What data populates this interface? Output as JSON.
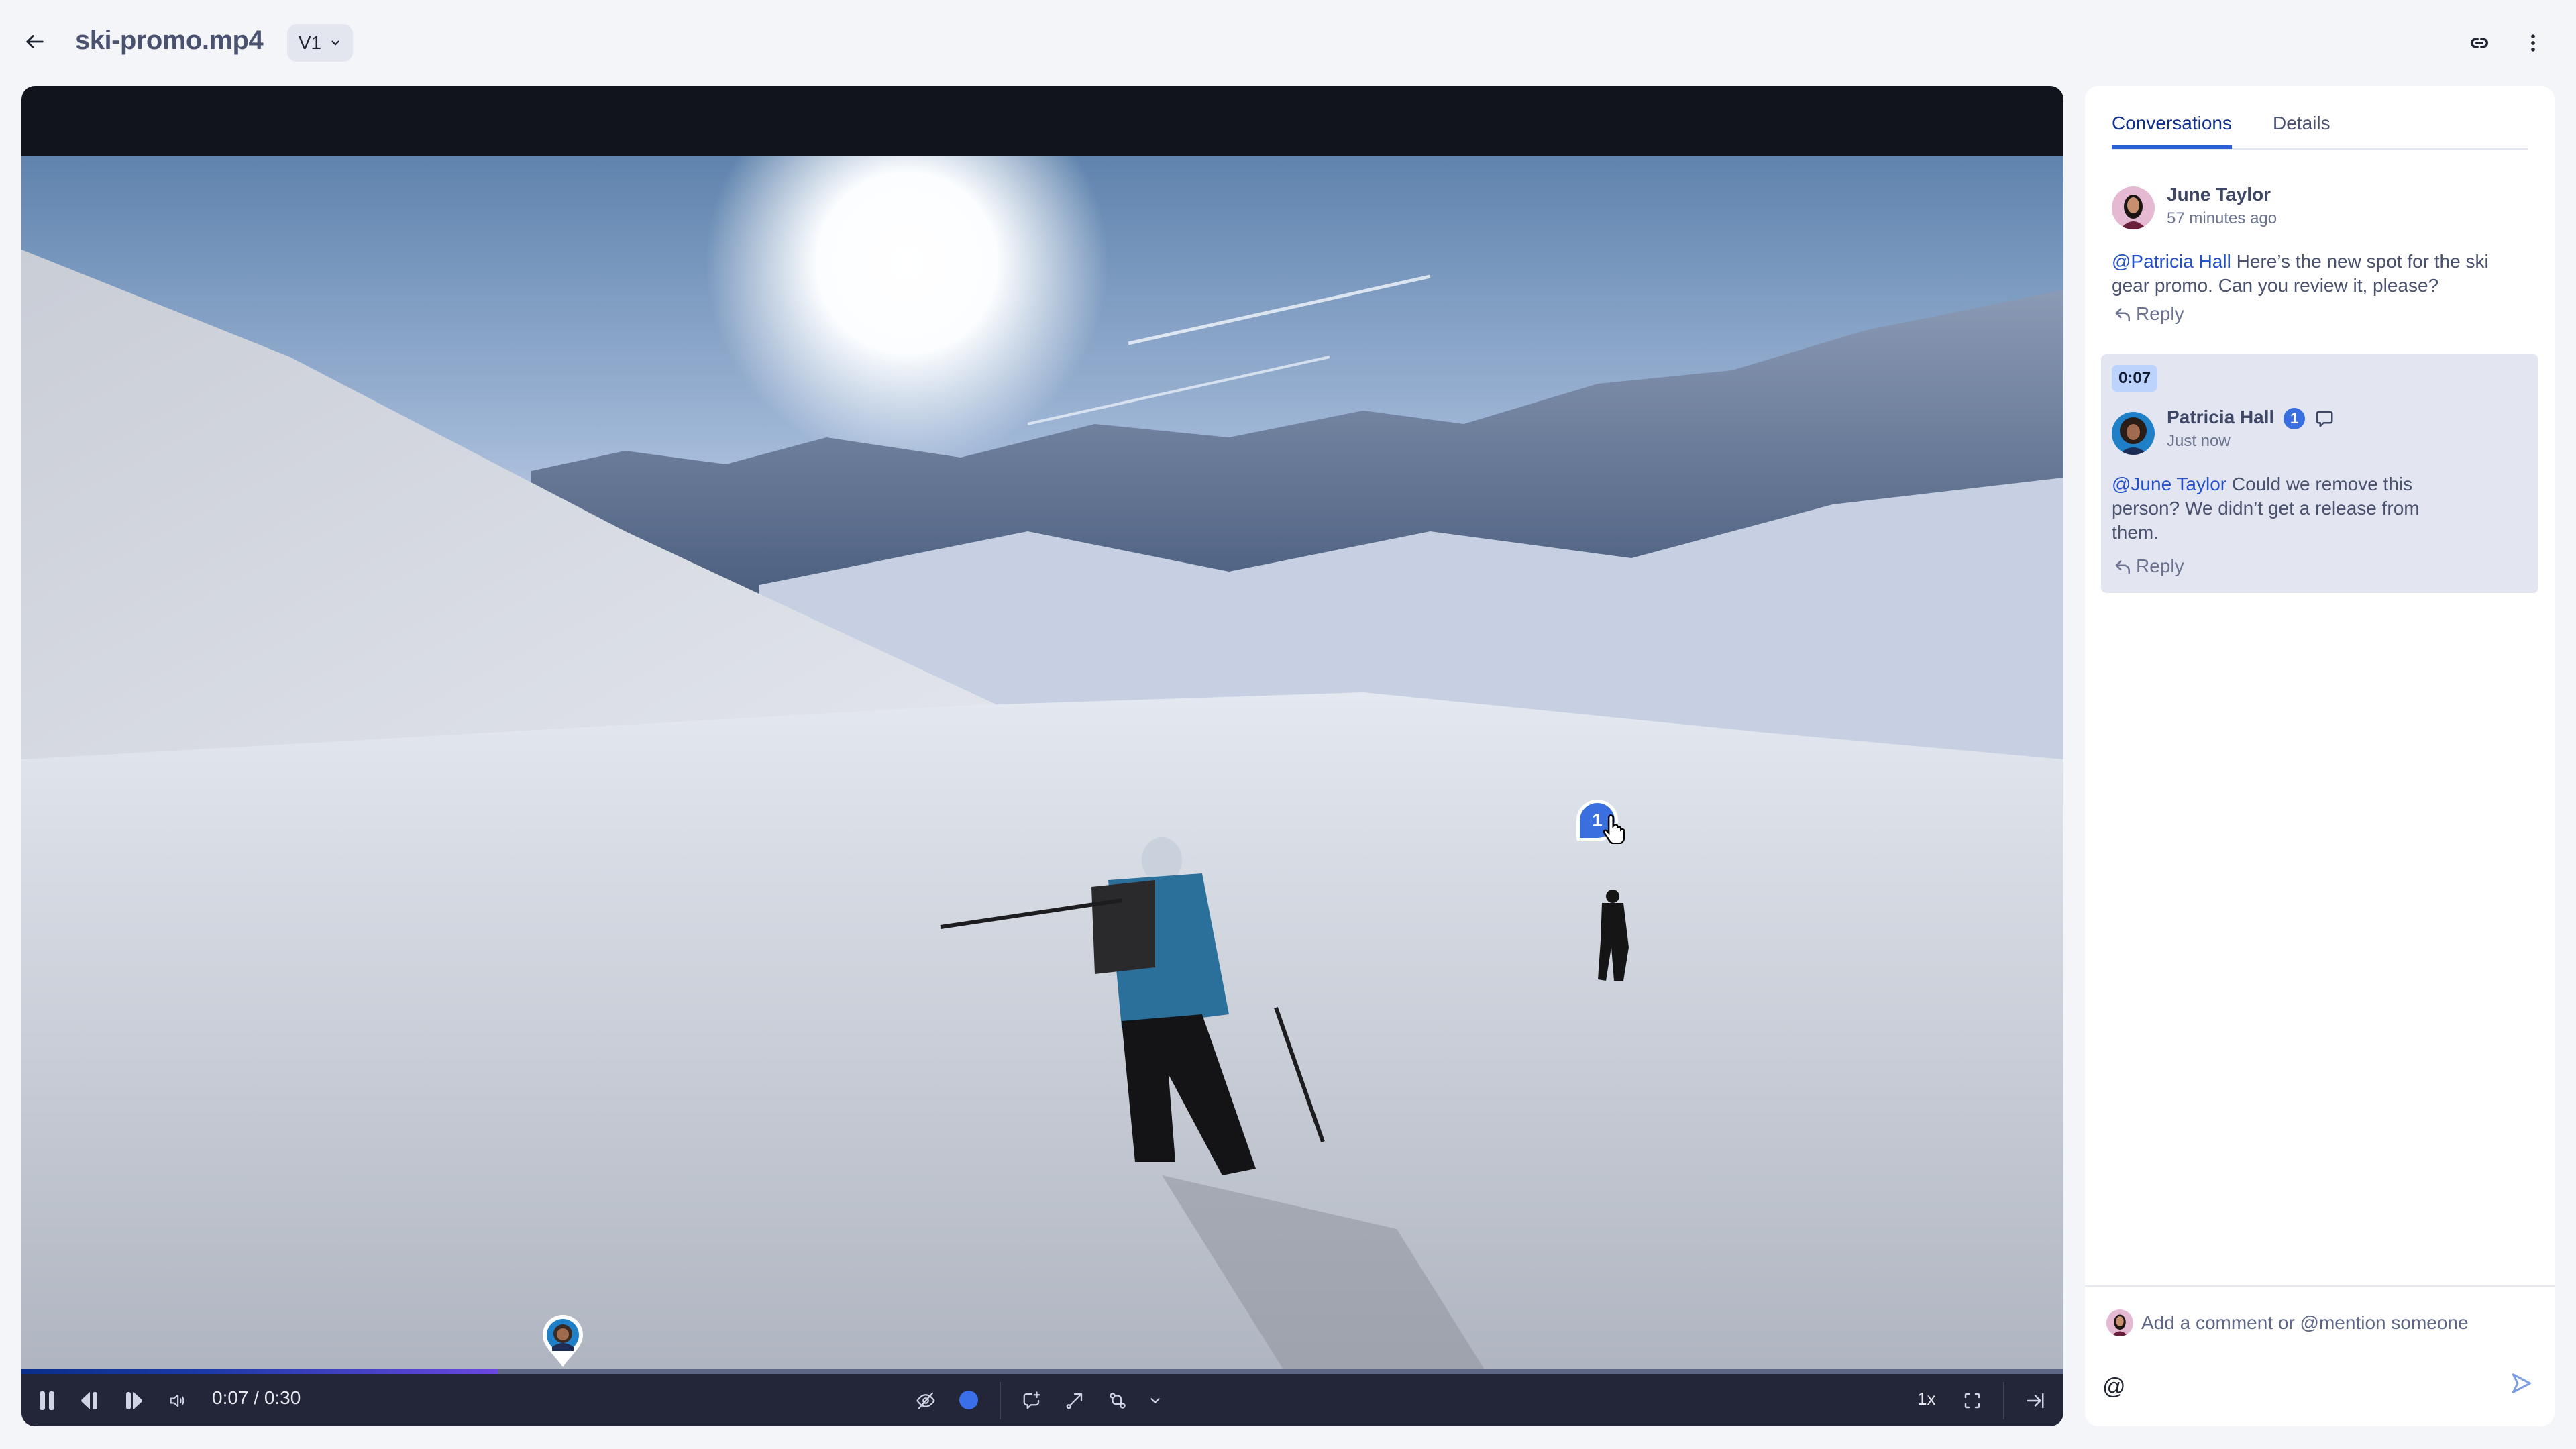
{
  "header": {
    "title": "ski-promo.mp4",
    "version": "V1",
    "icons": {
      "back": "arrow-left-icon",
      "link": "link-icon",
      "more": "more-vertical-icon"
    }
  },
  "player": {
    "current_time": "0:07",
    "duration": "0:30",
    "time_display": "0:07 / 0:30",
    "progress_fraction": 0.2333,
    "speed": "1x",
    "annotation_pin_label": "1",
    "annotation_color": "#3a6fe9",
    "icons": {
      "pause": "pause-icon",
      "step_back": "frame-back-icon",
      "step_forward": "frame-forward-icon",
      "volume": "volume-icon",
      "hide_annotations": "eye-off-icon",
      "color": "color-dot-icon",
      "comment": "comment-add-icon",
      "arrow": "arrow-draw-icon",
      "shape": "shape-icon",
      "more_tools": "chevron-down-icon",
      "fullscreen": "fullscreen-icon",
      "collapse_sidebar": "arrow-right-to-line-icon"
    }
  },
  "sidebar": {
    "tabs": [
      {
        "label": "Conversations",
        "active": true
      },
      {
        "label": "Details",
        "active": false
      }
    ],
    "comments": [
      {
        "author": "June Taylor",
        "time": "57 minutes ago",
        "mention": "@Patricia Hall",
        "text": " Here’s the new spot for the ski gear promo. Can you review it, please?",
        "reply_label": "Reply"
      },
      {
        "timestamp": "0:07",
        "author": "Patricia Hall",
        "badge": "1",
        "time": "Just now",
        "mention": "@June Taylor",
        "text": " Could we remove this person? We didn’t get a release from them.",
        "reply_label": "Reply"
      }
    ],
    "composer": {
      "placeholder": "Add a comment or @mention someone",
      "value": "",
      "at_label": "@"
    }
  },
  "colors": {
    "accent": "#2c5fd6",
    "mention": "#2350c9",
    "highlight_bg": "#e3e6f0",
    "player_bg": "#11141d"
  }
}
